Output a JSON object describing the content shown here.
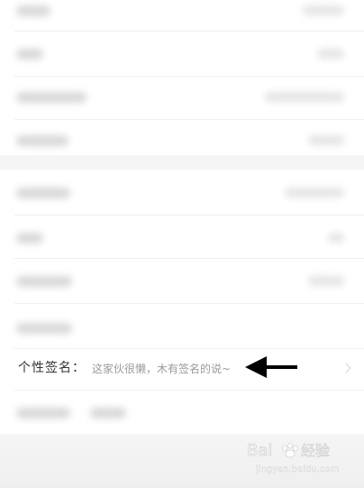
{
  "profile": {
    "signature_label": "个性签名：",
    "signature_value": "这家伙很懒，木有签名的说~"
  },
  "icons": {
    "arrow": "arrow-left-icon",
    "chevron": "chevron-right-icon",
    "watermark": "baidu-paw-icon"
  },
  "colors": {
    "background": "#f5f5f5",
    "row": "#ffffff",
    "label_text": "#333333",
    "value_text": "#9a9a9a"
  },
  "watermark": {
    "brand": "Bai",
    "brand_tail": "经验",
    "url": "jingyan.baidu.com"
  }
}
